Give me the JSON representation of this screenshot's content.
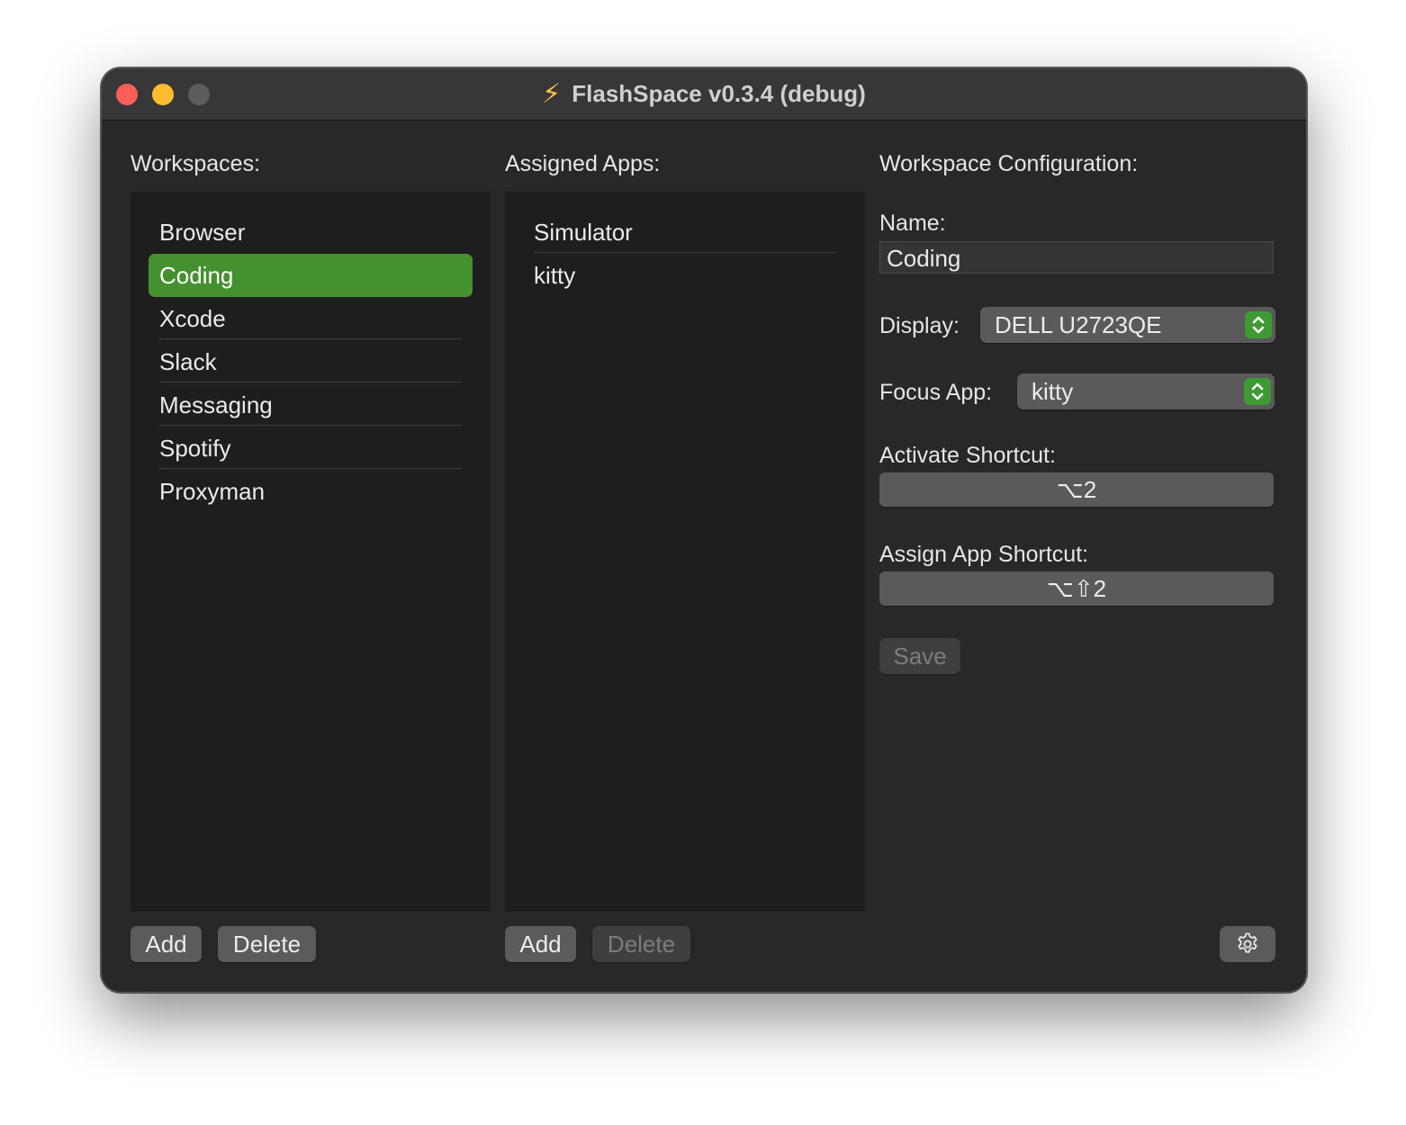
{
  "window": {
    "title": "FlashSpace v0.3.4 (debug)",
    "title_icon": "lightning-bolt-icon"
  },
  "workspaces": {
    "header": "Workspaces:",
    "items": [
      "Browser",
      "Coding",
      "Xcode",
      "Slack",
      "Messaging",
      "Spotify",
      "Proxyman"
    ],
    "selected": "Coding",
    "add_label": "Add",
    "delete_label": "Delete"
  },
  "assigned_apps": {
    "header": "Assigned Apps:",
    "items": [
      "Simulator",
      "kitty"
    ],
    "add_label": "Add",
    "delete_label": "Delete"
  },
  "config": {
    "header": "Workspace Configuration:",
    "name_label": "Name:",
    "name_value": "Coding",
    "display_label": "Display:",
    "display_value": "DELL U2723QE",
    "focus_label": "Focus App:",
    "focus_value": "kitty",
    "activate_label": "Activate Shortcut:",
    "activate_value": "⌥2",
    "assign_label": "Assign App Shortcut:",
    "assign_value": "⌥⇧2",
    "save_label": "Save"
  },
  "colors": {
    "accent": "#43912f",
    "window_bg": "#282828",
    "panel_bg": "#1e1e1e",
    "titlebar_bg": "#373737"
  }
}
